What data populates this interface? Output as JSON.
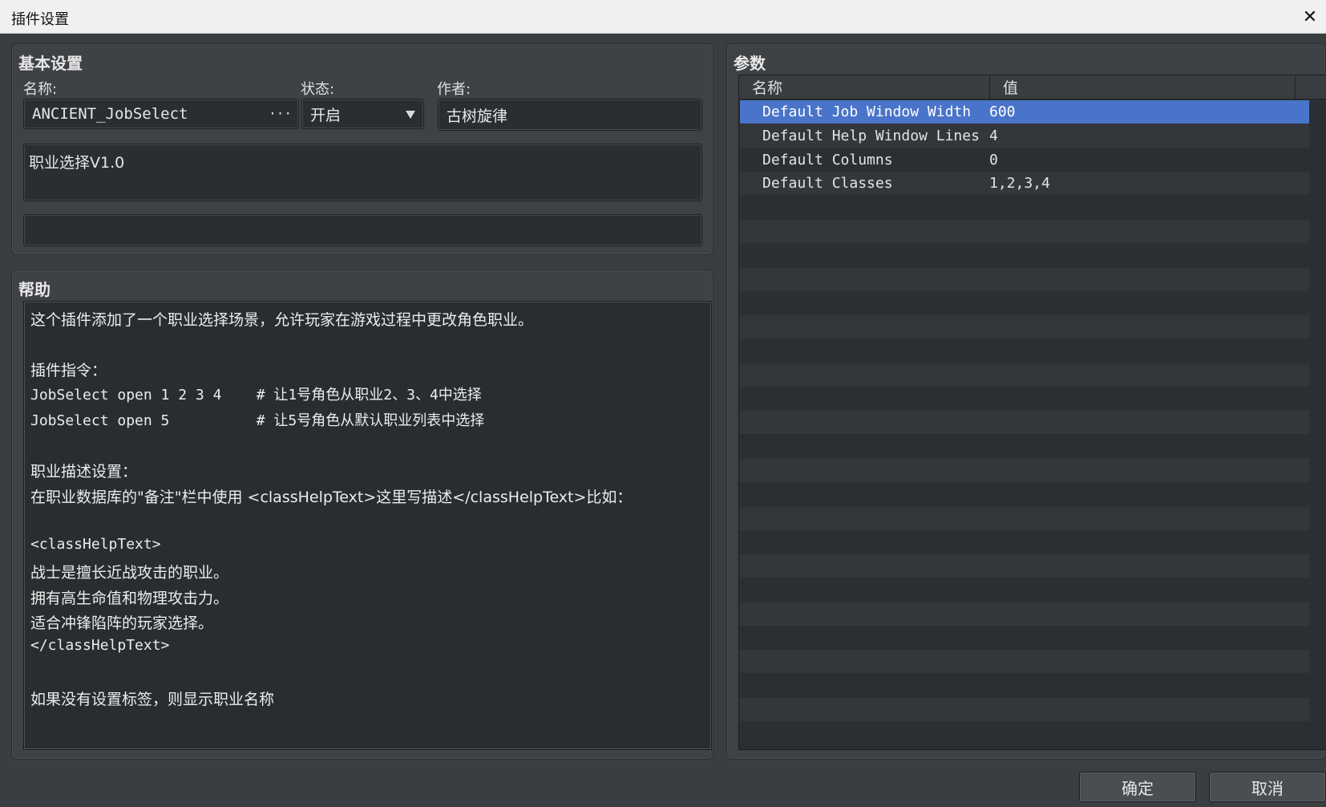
{
  "window": {
    "title": "插件设置"
  },
  "basic": {
    "heading": "基本设置",
    "name_label": "名称:",
    "name_value": "ANCIENT_JobSelect",
    "name_browse": "···",
    "status_label": "状态:",
    "status_value": "开启",
    "author_label": "作者:",
    "author_value": "古树旋律",
    "description": "职业选择V1.0",
    "extra": ""
  },
  "help": {
    "heading": "帮助",
    "lines": [
      "这个插件添加了一个职业选择场景，允许玩家在游戏过程中更改角色职业。",
      "",
      "插件指令：",
      "JobSelect open 1 2 3 4    # 让1号角色从职业2、3、4中选择",
      "JobSelect open 5          # 让5号角色从默认职业列表中选择",
      "",
      "职业描述设置：",
      "在职业数据库的\"备注\"栏中使用 <classHelpText>这里写描述</classHelpText>比如：",
      "",
      "<classHelpText>",
      "战士是擅长近战攻击的职业。",
      "拥有高生命值和物理攻击力。",
      "适合冲锋陷阵的玩家选择。",
      "</classHelpText>",
      "",
      "如果没有设置标签，则显示职业名称"
    ]
  },
  "params": {
    "heading": "参数",
    "columns": [
      "名称",
      "值"
    ],
    "rows": [
      {
        "name": "Default Job Window Width",
        "value": "600",
        "selected": true
      },
      {
        "name": "Default Help Window Lines",
        "value": "4",
        "selected": false
      },
      {
        "name": "Default Columns",
        "value": "0",
        "selected": false
      },
      {
        "name": "Default Classes",
        "value": "1,2,3,4",
        "selected": false
      }
    ]
  },
  "buttons": {
    "ok": "确定",
    "cancel": "取消"
  },
  "icons": {
    "close": "close-icon",
    "dropdown": "chevron-down-icon"
  }
}
